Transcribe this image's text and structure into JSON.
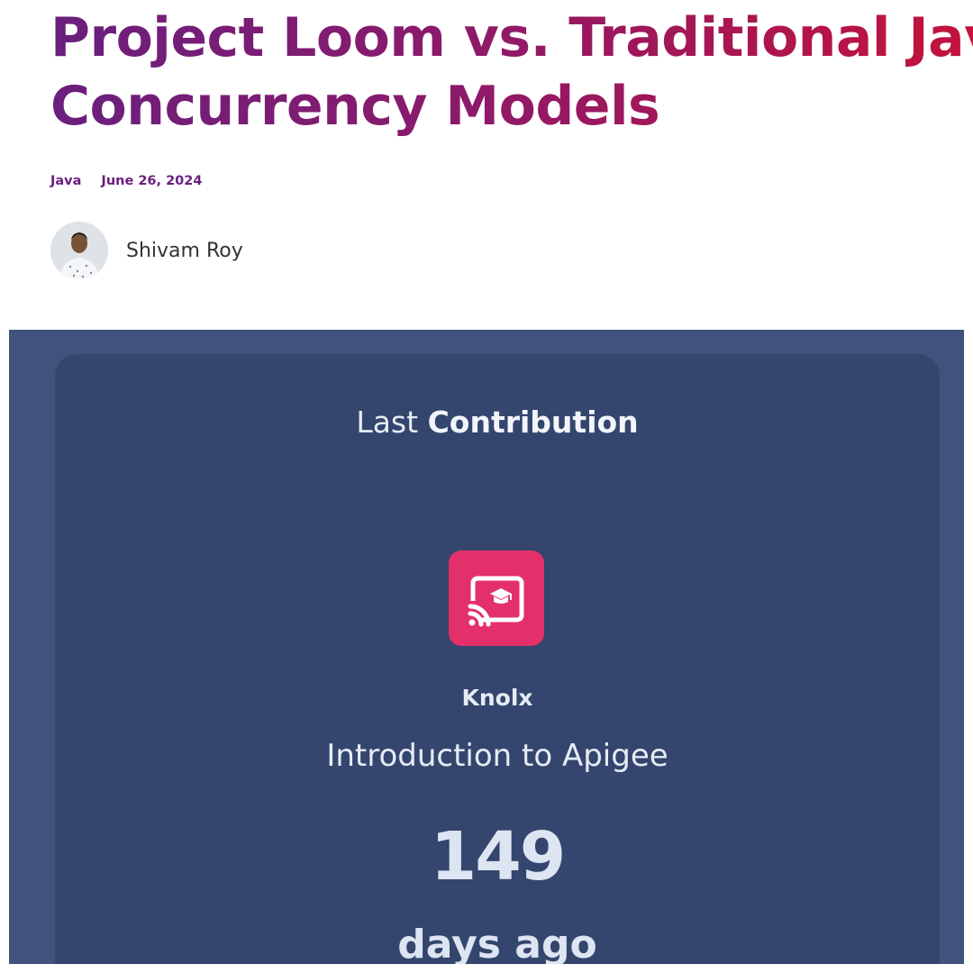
{
  "post": {
    "title_line1": "Project Loom vs. Traditional Java",
    "title_line2": "Concurrency Models",
    "category": "Java",
    "date": "June 26, 2024",
    "author": {
      "name": "Shivam Roy",
      "avatar_icon": "author-avatar-photo"
    }
  },
  "contribution_card": {
    "heading_light": "Last",
    "heading_bold": "Contribution",
    "icon": "cast-graduation-cap-icon",
    "category": "Knolx",
    "title": "Introduction to Apigee",
    "days_count": "149",
    "days_label": "days ago"
  },
  "colors": {
    "title_gradient_start": "#6a1f7e",
    "title_gradient_end": "#c4123c",
    "meta": "#6a1f7e",
    "banner_bg": "#41537c",
    "card_bg": "#34466d",
    "icon_bg": "#e3306b",
    "card_text": "#e6ebf5"
  }
}
